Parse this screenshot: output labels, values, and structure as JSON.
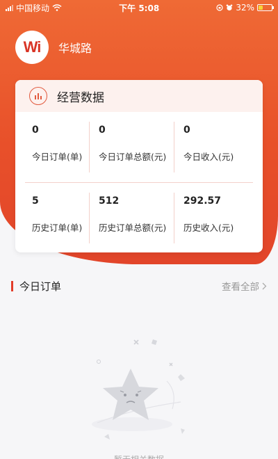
{
  "status_bar": {
    "carrier": "中国移动",
    "time": "下午 5:08",
    "battery_percent": "32%",
    "battery_level": 0.32
  },
  "store": {
    "logo_text": "Wi",
    "name": "华城路"
  },
  "business_card": {
    "title": "经营数据",
    "icon": "bar-chart-icon",
    "today": [
      {
        "value": "0",
        "label": "今日订单(单)"
      },
      {
        "value": "0",
        "label": "今日订单总额(元)"
      },
      {
        "value": "0",
        "label": "今日收入(元)"
      }
    ],
    "history": [
      {
        "value": "5",
        "label": "历史订单(单)"
      },
      {
        "value": "512",
        "label": "历史订单总额(元)"
      },
      {
        "value": "292.57",
        "label": "历史收入(元)"
      }
    ]
  },
  "today_orders": {
    "title": "今日订单",
    "view_all": "查看全部"
  },
  "empty_state": {
    "text": "暂无相关数据",
    "icon": "sad-star-icon"
  },
  "colors": {
    "accent": "#e8502a",
    "accent_dark": "#e23c2a",
    "card_head_bg": "#fdf1ee"
  }
}
